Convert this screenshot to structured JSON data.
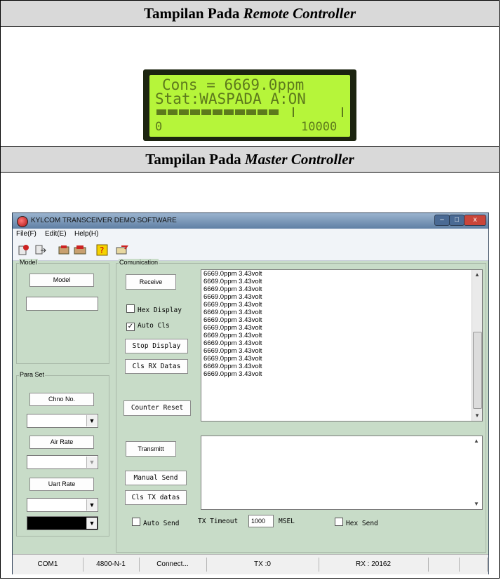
{
  "remote_section": {
    "title_prefix": "Tampilan Pada ",
    "title_italic": "Remote Controller",
    "lcd": {
      "line1": "Cons = 6669.0ppm",
      "line2": "Stat:WASPADA A:ON",
      "scale_min": "0",
      "scale_max": "10000",
      "bar_level_percent": 67,
      "screen_color": "#b6f53a",
      "text_color": "#5d7a1c"
    }
  },
  "master_section": {
    "title_prefix": "Tampilan Pada ",
    "title_italic": "Master Controller"
  },
  "window": {
    "title": "KYLCOM TRANSCEIVER DEMO SOFTWARE",
    "menu": [
      "File(F)",
      "Edit(E)",
      "Help(H)"
    ],
    "toolbar_icons": [
      "open-file-icon",
      "export-icon",
      "settings-icon",
      "transfer-icon",
      "help-icon",
      "send-icon"
    ],
    "model_group": {
      "label": "Model",
      "button": "Model"
    },
    "para_group": {
      "label": "Para Set",
      "chno_button": "Chno No.",
      "air_button": "Air Rate",
      "uart_button": "Uart Rate"
    },
    "comm_group": {
      "label": "Comunication",
      "receive_button": "Receive",
      "hex_display": "Hex Display",
      "auto_cls": "Auto Cls",
      "stop_display_button": "Stop Display",
      "cls_rx_button": "Cls RX Datas",
      "counter_reset_button": "Counter Reset",
      "transmit_button": "Transmitt",
      "manual_send_button": "Manual Send",
      "cls_tx_button": "Cls TX datas",
      "auto_send": "Auto Send",
      "tx_timeout_label": "TX Timeout",
      "tx_timeout_value": "1000",
      "msel_label": "MSEL",
      "hex_send": "Hex Send",
      "rx_lines": [
        "6669.0ppm 3.43volt",
        "6669.0ppm 3.43volt",
        "6669.0ppm 3.43volt",
        "6669.0ppm 3.43volt",
        "6669.0ppm 3.43volt",
        "6669.0ppm 3.43volt",
        "6669.0ppm 3.43volt",
        "6669.0ppm 3.43volt",
        "6669.0ppm 3.43volt",
        "6669.0ppm 3.43volt",
        "6669.0ppm 3.43volt",
        "6669.0ppm 3.43volt",
        "6669.0ppm 3.43volt",
        "6669.0ppm 3.43volt"
      ]
    },
    "status": {
      "port": "COM1",
      "settings": "4800-N-1",
      "connection": "Connect...",
      "tx": "TX :0",
      "rx": "RX : 20162"
    }
  }
}
